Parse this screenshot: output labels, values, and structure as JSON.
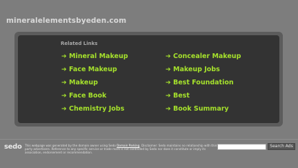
{
  "header": {
    "site_title": "mineralelementsbyeden.com"
  },
  "related": {
    "heading": "Related Links",
    "arrow": "➔",
    "left_links": [
      "Mineral Makeup",
      "Face Makeup",
      "Makeup",
      "Face Book",
      "Chemistry Jobs"
    ],
    "right_links": [
      "Concealer Makeup",
      "Makeup Jobs",
      "Best Foundation",
      "Best",
      "Book Summary"
    ],
    "link_color": "#a6e22c"
  },
  "footer": {
    "logo_text": "sedo",
    "disclaimer_part1": "This webpage was generated by the domain owner using Sedo ",
    "disclaimer_link": "Domain Parking",
    "disclaimer_part2": ". Disclaimer: Sedo maintains no relationship with third party advertisers. Reference to any specific service or trade mark is not controlled by Sedo nor does it constitute or imply its association, endorsement or recommendation.",
    "search_placeholder": "",
    "search_button": "Search Ads"
  }
}
